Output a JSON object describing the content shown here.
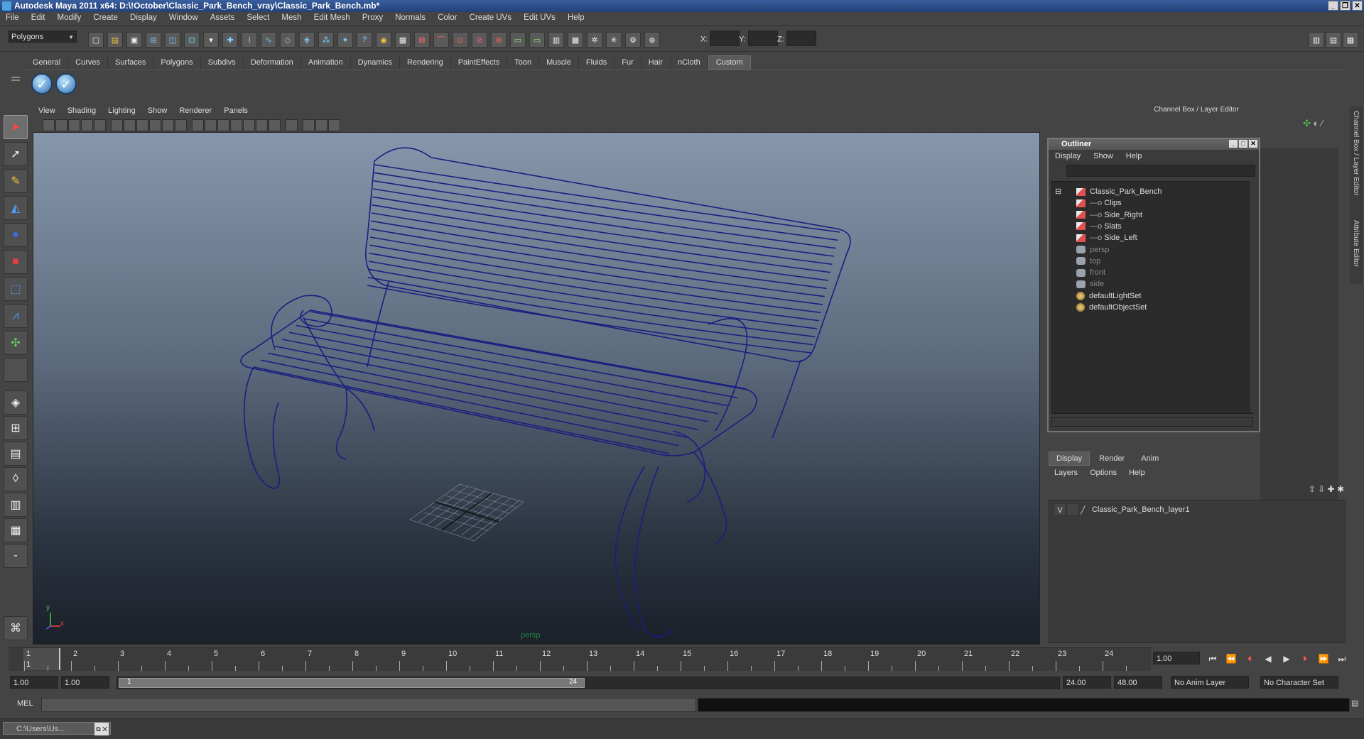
{
  "window": {
    "title": "Autodesk Maya 2011 x64: D:\\!October\\Classic_Park_Bench_vray\\Classic_Park_Bench.mb*",
    "controls": [
      "_",
      "❐",
      "✕"
    ]
  },
  "menubar": [
    "File",
    "Edit",
    "Modify",
    "Create",
    "Display",
    "Window",
    "Assets",
    "Select",
    "Mesh",
    "Edit Mesh",
    "Proxy",
    "Normals",
    "Color",
    "Create UVs",
    "Edit UVs",
    "Help"
  ],
  "status_line": {
    "mode": "Polygons",
    "coord_labels": [
      "X:",
      "Y:",
      "Z:"
    ]
  },
  "shelf": {
    "tabs": [
      "General",
      "Curves",
      "Surfaces",
      "Polygons",
      "Subdivs",
      "Deformation",
      "Animation",
      "Dynamics",
      "Rendering",
      "PaintEffects",
      "Toon",
      "Muscle",
      "Fluids",
      "Fur",
      "Hair",
      "nCloth",
      "Custom"
    ],
    "active_tab": "Custom"
  },
  "viewport": {
    "menu": [
      "View",
      "Shading",
      "Lighting",
      "Show",
      "Renderer",
      "Panels"
    ],
    "camera_label": "persp",
    "axis_x": "x",
    "axis_y": "y",
    "wire_color": "#1a1e80"
  },
  "right_panel": {
    "header": "Channel Box / Layer Editor",
    "side_tabs": [
      "Channel Box / Layer Editor",
      "Attribute Editor"
    ]
  },
  "outliner": {
    "title": "Outliner",
    "menu": [
      "Display",
      "Show",
      "Help"
    ],
    "items": [
      {
        "label": "Classic_Park_Bench",
        "indent": 0,
        "icon": "mesh-group-icon",
        "dim": false
      },
      {
        "label": "Clips",
        "indent": 1,
        "icon": "mesh-icon",
        "dim": false
      },
      {
        "label": "Side_Right",
        "indent": 1,
        "icon": "mesh-icon",
        "dim": false
      },
      {
        "label": "Slats",
        "indent": 1,
        "icon": "mesh-icon",
        "dim": false
      },
      {
        "label": "Side_Left",
        "indent": 1,
        "icon": "mesh-icon",
        "dim": false
      },
      {
        "label": "persp",
        "indent": 0,
        "icon": "camera-icon",
        "dim": true
      },
      {
        "label": "top",
        "indent": 0,
        "icon": "camera-icon",
        "dim": true
      },
      {
        "label": "front",
        "indent": 0,
        "icon": "camera-icon",
        "dim": true
      },
      {
        "label": "side",
        "indent": 0,
        "icon": "camera-icon",
        "dim": true
      },
      {
        "label": "defaultLightSet",
        "indent": 0,
        "icon": "set-icon",
        "dim": false
      },
      {
        "label": "defaultObjectSet",
        "indent": 0,
        "icon": "set-icon",
        "dim": false
      }
    ]
  },
  "layer_editor": {
    "tabs": [
      "Display",
      "Render",
      "Anim"
    ],
    "active_tab": "Display",
    "menu": [
      "Layers",
      "Options",
      "Help"
    ],
    "layers": [
      {
        "visible": "V",
        "name": "Classic_Park_Bench_layer1"
      }
    ]
  },
  "timeline": {
    "ticks": [
      "1",
      "2",
      "3",
      "4",
      "5",
      "6",
      "7",
      "8",
      "9",
      "10",
      "11",
      "12",
      "13",
      "14",
      "15",
      "16",
      "17",
      "18",
      "19",
      "20",
      "21",
      "22",
      "23",
      "24"
    ],
    "current_frame": "1",
    "current_time_field": "1.00"
  },
  "range": {
    "start_time": "1.00",
    "playback_start": "1.00",
    "slider_start": "1",
    "slider_end": "24",
    "playback_end": "24.00",
    "end_time": "48.00",
    "anim_layer": "No Anim Layer",
    "character_set": "No Character Set"
  },
  "command_line": {
    "label": "MEL"
  },
  "taskbar": {
    "item": "C:\\Users\\Us..."
  }
}
